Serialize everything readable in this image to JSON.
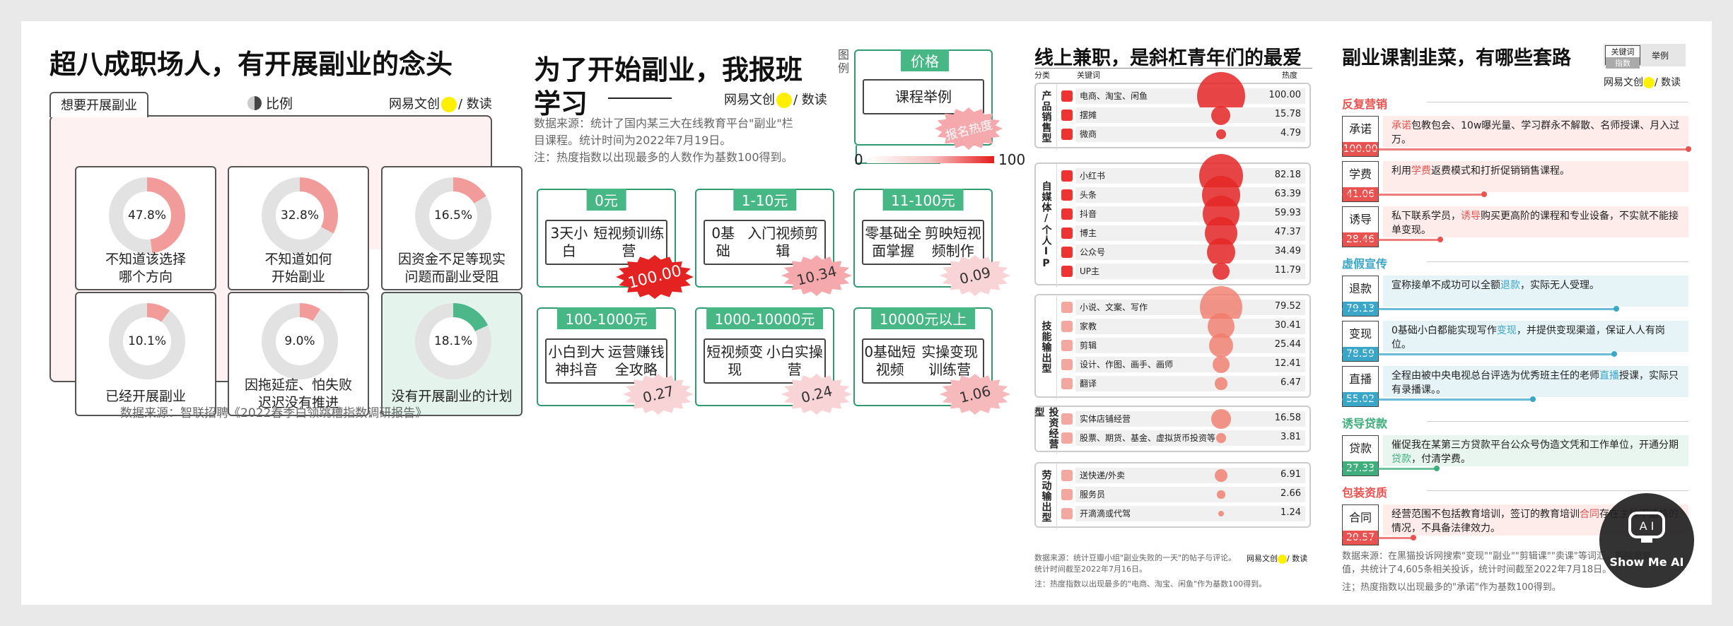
{
  "panel1": {
    "title": "超八成职场人，有开展副业的念头",
    "group_label": "想要开展副业",
    "legend_icon": "pie-legend-icon",
    "legend": "比例",
    "brand": "网易文创",
    "brand_suffix": "/ 数读",
    "source": "数据来源：智联招聘《2022春季白领跳槽指数调研报告》",
    "colors": {
      "want": "#f29b9b",
      "no_plan": "#4cb88a",
      "track": "#e2e2e2"
    }
  },
  "panel2": {
    "title_line1": "为了开始副业，我报班",
    "title_line2": "学习",
    "brand": "网易文创",
    "brand_suffix": "/ 数读",
    "source_line1": "数据来源：统计了国内某三大在线教育平台\"副业\"栏",
    "source_line2": "目课程。统计时间为2022年7月19日。",
    "note": "注：热度指数以出现最多的人数作为基数100得到。",
    "legend_label": "图例",
    "legend_price": "价格",
    "legend_course": "课程举例",
    "legend_heat": "报名热度",
    "scale_min": "0",
    "scale_max": "100"
  },
  "panel3": {
    "title": "线上兼职，是斜杠青年们的最爱",
    "col_cat": "分类",
    "col_kw": "关键词",
    "col_heat": "热度",
    "brand": "网易文创",
    "brand_suffix": "/ 数读",
    "source_line1": "数据来源：统计豆瓣小组\"副业失败的一天\"的帖子与评论。",
    "source_line2": "统计时间截至2022年7月16日。",
    "note": "注：热度指数以出现最多的\"电商、淘宝、闲鱼\"作为基数100得到。"
  },
  "panel4": {
    "title": "副业课割韭菜，有哪些套路",
    "legend_kw": "关键词",
    "legend_idx": "指数",
    "legend_example": "举例",
    "brand": "网易文创",
    "brand_suffix": "/ 数读",
    "source_line1": "数据来源：在黑猫投诉网搜索\"变现\"\"副业\"\"剪辑课\"\"卖课\"等词汇，剔除重复值，共统计了4,605条相关投诉，统计时间截至2022年7月18日。",
    "note": "注；热度指数以出现最多的\"承诺\"作为基数100得到。",
    "logo_text": "Show Me AI"
  },
  "chart_data": [
    {
      "type": "donut",
      "title": "超八成职场人，有开展副业的念头",
      "series": [
        {
          "name": "想要开展副业",
          "values": [
            {
              "label": "不知道该选择哪个方向",
              "value": 47.8
            },
            {
              "label": "不知道如何开始副业",
              "value": 32.8
            },
            {
              "label": "因资金不足等现实问题而副业受阻",
              "value": 16.5
            },
            {
              "label": "已经开展副业",
              "value": 10.1
            },
            {
              "label": "因拖延症、怕失败迟迟没有推进",
              "value": 9.0
            }
          ]
        },
        {
          "name": "",
          "values": [
            {
              "label": "没有开展副业的计划",
              "value": 18.1
            }
          ]
        }
      ],
      "unit": "%"
    },
    {
      "type": "table",
      "title": "为了开始副业，我报班学习",
      "columns": [
        "价格",
        "课程举例",
        "报名热度"
      ],
      "rows": [
        {
          "price": "0元",
          "course_line1": "3天小白",
          "course_line2": "短视频训练营",
          "heat": "100.00"
        },
        {
          "price": "1-10元",
          "course_line1": "0基础",
          "course_line2": "入门视频剪辑",
          "heat": "10.34"
        },
        {
          "price": "11-100元",
          "course_line1": "零基础全面掌握",
          "course_line2": "剪映短视频制作",
          "heat": "0.09"
        },
        {
          "price": "100-1000元",
          "course_line1": "小白到大神抖音",
          "course_line2": "运营赚钱全攻略",
          "heat": "0.27"
        },
        {
          "price": "1000-10000元",
          "course_line1": "短视频变现",
          "course_line2": "小白实操营",
          "heat": "0.24"
        },
        {
          "price": "10000元以上",
          "course_line1": "0基础短视频",
          "course_line2": "实操变现训练营",
          "heat": "1.06"
        }
      ]
    },
    {
      "type": "scatter",
      "title": "线上兼职，是斜杠青年们的最爱",
      "groups": [
        {
          "category": "产品销售型",
          "items": [
            {
              "kw": "电商、淘宝、闲鱼",
              "heat": "100.00"
            },
            {
              "kw": "摆摊",
              "heat": "15.78"
            },
            {
              "kw": "微商",
              "heat": "4.79"
            }
          ]
        },
        {
          "category": "自媒体/个人IP",
          "items": [
            {
              "kw": "小红书",
              "heat": "82.18"
            },
            {
              "kw": "头条",
              "heat": "63.39"
            },
            {
              "kw": "抖音",
              "heat": "59.93"
            },
            {
              "kw": "博主",
              "heat": "47.37"
            },
            {
              "kw": "公众号",
              "heat": "34.49"
            },
            {
              "kw": "UP主",
              "heat": "11.79"
            }
          ]
        },
        {
          "category": "技能输出型",
          "items": [
            {
              "kw": "小说、文案、写作",
              "heat": "79.52"
            },
            {
              "kw": "家教",
              "heat": "30.41"
            },
            {
              "kw": "剪辑",
              "heat": "25.44"
            },
            {
              "kw": "设计、作图、画手、画师",
              "heat": "12.41"
            },
            {
              "kw": "翻译",
              "heat": "6.47"
            }
          ]
        },
        {
          "category": "投资经营型",
          "items": [
            {
              "kw": "实体店铺经营",
              "heat": "16.58"
            },
            {
              "kw": "股票、期货、基金、虚拟货币投资等",
              "heat": "3.81"
            }
          ]
        },
        {
          "category": "劳动输出型",
          "items": [
            {
              "kw": "送快递/外卖",
              "heat": "6.91"
            },
            {
              "kw": "服务员",
              "heat": "2.66"
            },
            {
              "kw": "开滴滴或代驾",
              "heat": "1.24"
            }
          ]
        }
      ]
    },
    {
      "type": "bar",
      "title": "副业课割韭菜，有哪些套路",
      "sections": [
        {
          "name": "反复营销",
          "color": "#e8524f",
          "items": [
            {
              "kw": "承诺",
              "value": "100.00",
              "pre": "",
              "hl": "承诺",
              "post": "包教包会、10w曝光量、学习群永不解散、名师授课、月入过万。"
            },
            {
              "kw": "学费",
              "value": "41.06",
              "pre": "利用",
              "hl": "学费",
              "post": "返费模式和打折促销销售课程。"
            },
            {
              "kw": "诱导",
              "value": "28.46",
              "pre": "私下联系学员，",
              "hl": "诱导",
              "post": "购买更高阶的课程和专业设备，不实就不能接单变现。"
            }
          ]
        },
        {
          "name": "虚假宣传",
          "color": "#3aa6c8",
          "items": [
            {
              "kw": "退款",
              "value": "79.13",
              "pre": "宣称接单不成功可以全额",
              "hl": "退款",
              "post": "，实际无人受理。"
            },
            {
              "kw": "变现",
              "value": "78.59",
              "pre": "0基础小白都能实现写作",
              "hl": "变现",
              "post": "，并提供变现渠道，保证人人有岗位。"
            },
            {
              "kw": "直播",
              "value": "55.02",
              "pre": "全程由被中央电视总台评选为优秀班主任的老师",
              "hl": "直播",
              "post": "授课，实际只有录播课。。"
            }
          ]
        },
        {
          "name": "诱导贷款",
          "color": "#3fae7c",
          "items": [
            {
              "kw": "贷款",
              "value": "27.33",
              "pre": "催促我在某第三方贷款平台公众号伪造文凭和工作单位，开通分期",
              "hl": "贷款",
              "post": "，付清学费。"
            }
          ]
        },
        {
          "name": "包装资质",
          "color": "#e8524f",
          "items": [
            {
              "kw": "合同",
              "value": "20.57",
              "pre": "经营范围不包括教育培训，签订的教育培训",
              "hl": "合同",
              "post": "存在主体不适格的情况，不具备法律效力。"
            }
          ]
        }
      ]
    }
  ]
}
